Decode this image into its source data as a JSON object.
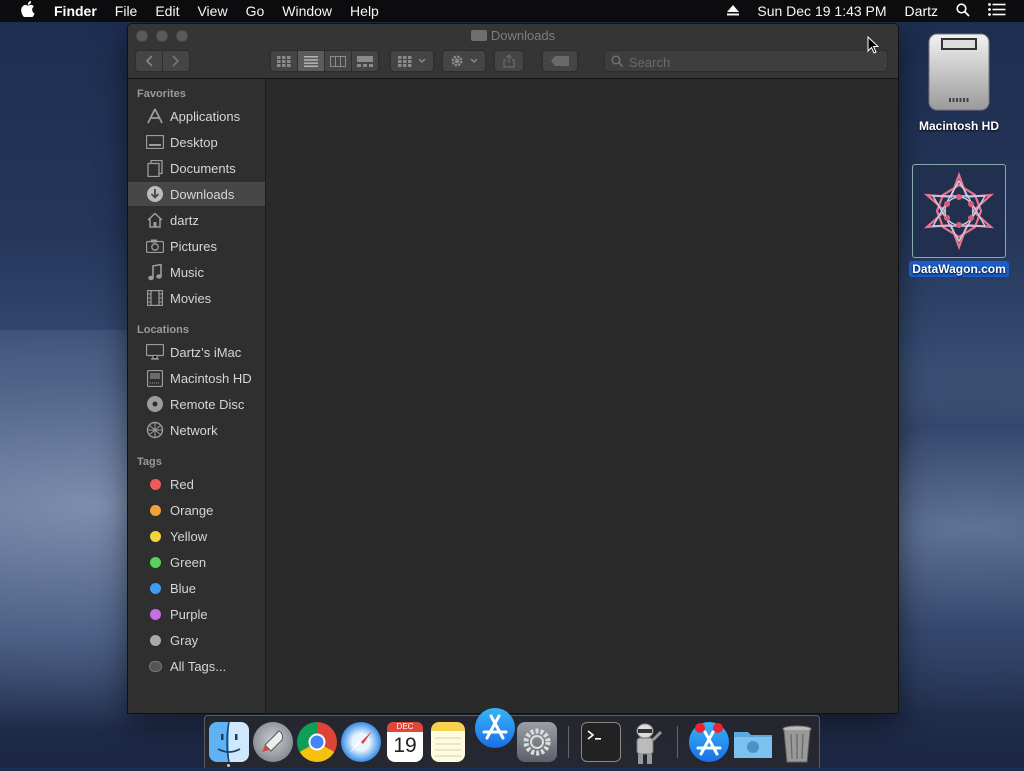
{
  "menubar": {
    "app": "Finder",
    "items": [
      "File",
      "Edit",
      "View",
      "Go",
      "Window",
      "Help"
    ],
    "clock": "Sun Dec 19  1:43 PM",
    "user": "Dartz"
  },
  "window": {
    "title": "Downloads",
    "search_placeholder": "Search"
  },
  "sidebar": {
    "favorites_header": "Favorites",
    "favorites": [
      "Applications",
      "Desktop",
      "Documents",
      "Downloads",
      "dartz",
      "Pictures",
      "Music",
      "Movies"
    ],
    "locations_header": "Locations",
    "locations": [
      "Dartz’s iMac",
      "Macintosh HD",
      "Remote Disc",
      "Network"
    ],
    "tags_header": "Tags",
    "tags": [
      {
        "label": "Red",
        "color": "#ec5a5a"
      },
      {
        "label": "Orange",
        "color": "#f0a23a"
      },
      {
        "label": "Yellow",
        "color": "#f2d43b"
      },
      {
        "label": "Green",
        "color": "#5ad15a"
      },
      {
        "label": "Blue",
        "color": "#3f9cf0"
      },
      {
        "label": "Purple",
        "color": "#c56ee0"
      },
      {
        "label": "Gray",
        "color": "#a9a9a9"
      },
      {
        "label": "All Tags...",
        "color": "#555555"
      }
    ]
  },
  "desktop": {
    "icons": [
      "Macintosh HD",
      "DataWagon.com"
    ]
  },
  "dock": {
    "calendar_month": "DEC",
    "calendar_day": "19"
  }
}
